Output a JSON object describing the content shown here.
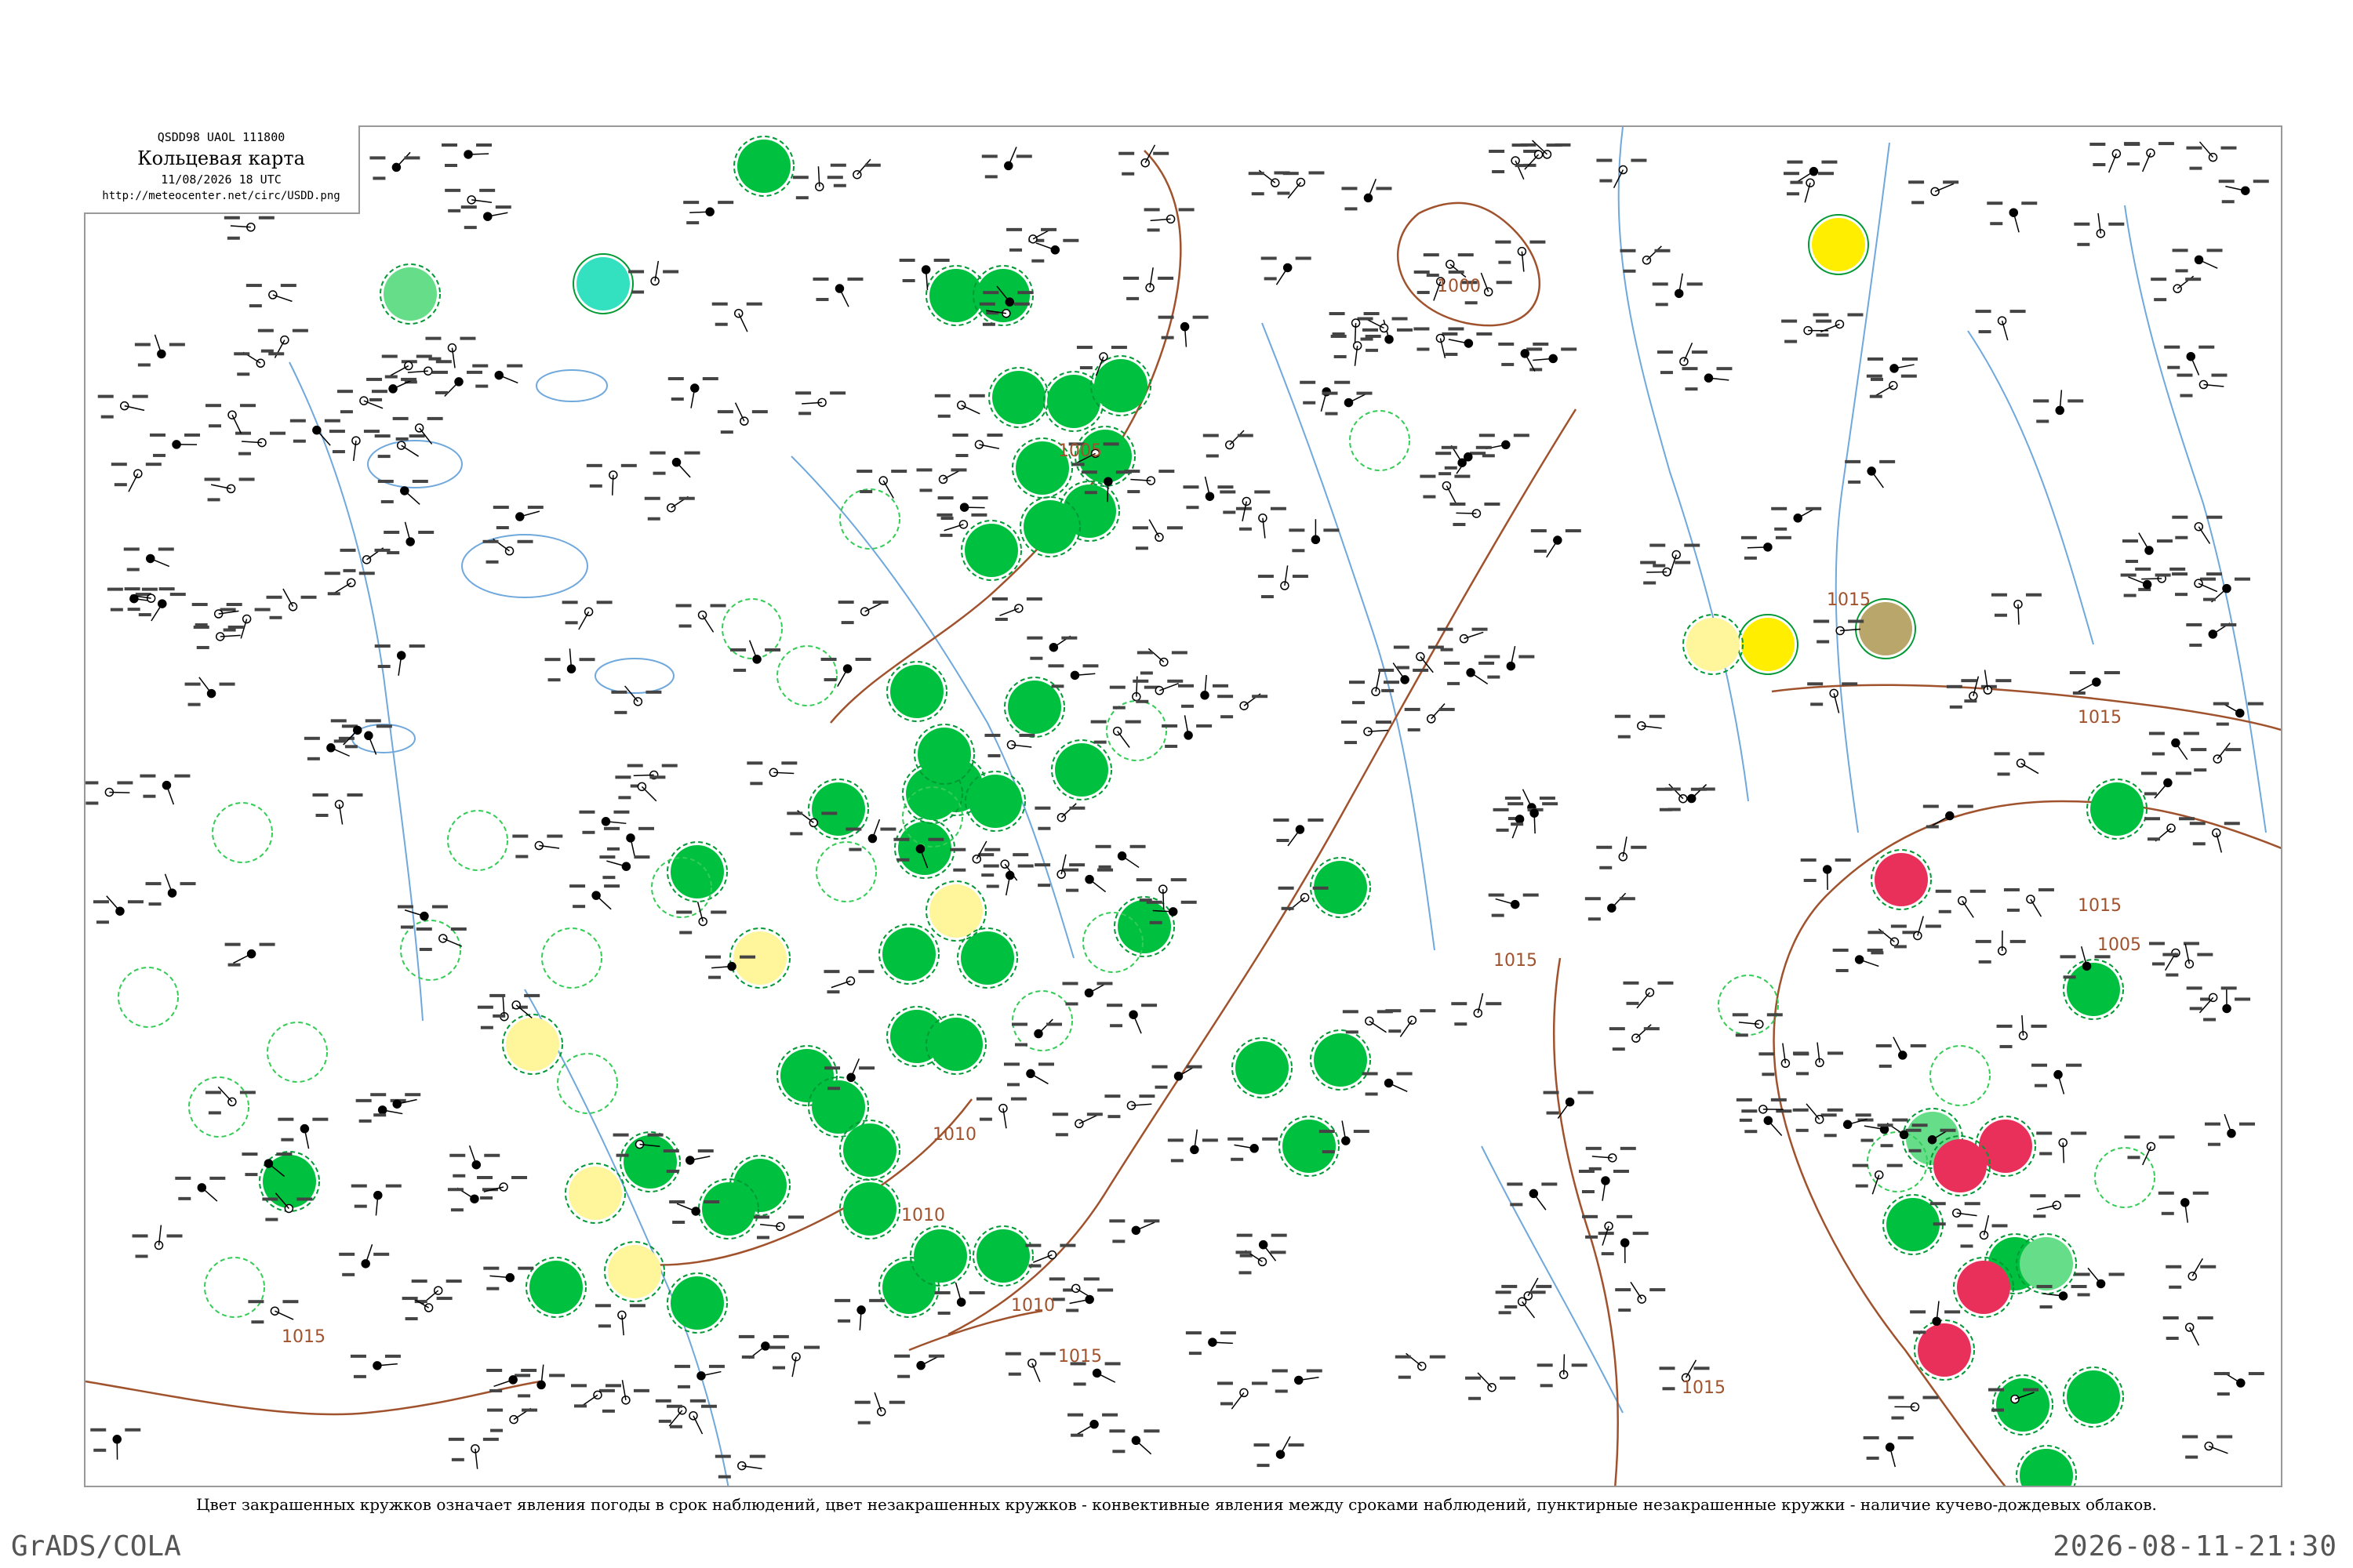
{
  "header": {
    "code_line": "QSDD98  UAOL  111800",
    "title": "Кольцевая карта",
    "time": "11/08/2026 18 UTC",
    "url": "http://meteocenter.net/circ/USDD.png"
  },
  "caption": "Цвет закрашенных кружков означает явления погоды в срок наблюдений, цвет незакрашенных кружков - конвективные явления между сроками наблюдений, пунктирные незакрашенные кружки - наличие кучево-дождевых облаков.",
  "footer": {
    "left": "GrADS/COLA",
    "right": "2026-08-11-21:30"
  },
  "colors": {
    "green_fill": "#00c040",
    "light_green_fill": "#66dd88",
    "cyan_fill": "#33e0c0",
    "yellow_fill": "#ffee00",
    "pale_yellow_fill": "#fff59a",
    "olive_fill": "#b8a66a",
    "red_fill": "#e8305a",
    "isobar": "#a0522d",
    "river": "#6fa8dc",
    "border": "#999999"
  },
  "isobar_labels": [
    "1000",
    "1005",
    "1010",
    "1015",
    "1010",
    "1015",
    "1015",
    "1015",
    "1015",
    "1010",
    "1015",
    "1005",
    "1015"
  ]
}
